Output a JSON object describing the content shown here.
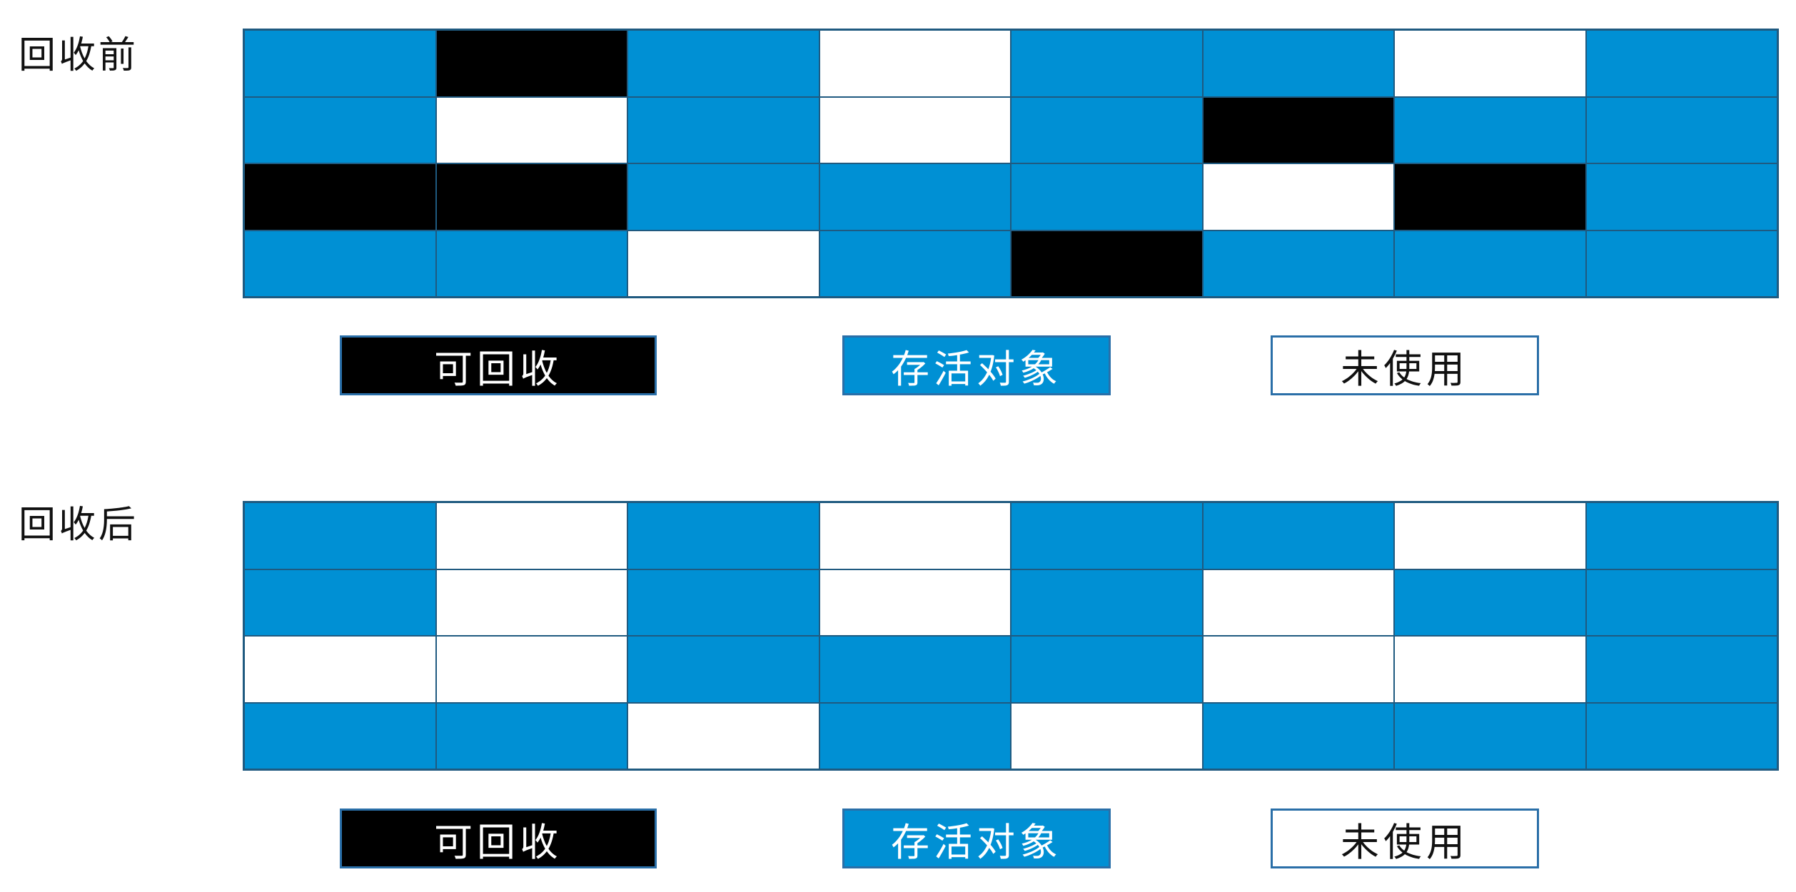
{
  "colors": {
    "recyclable": "#000000",
    "alive": "#0090d4",
    "unused": "#ffffff"
  },
  "sections": [
    {
      "label": "回收前",
      "grid": [
        [
          "alive",
          "recyclable",
          "alive",
          "unused",
          "alive",
          "alive",
          "unused",
          "alive"
        ],
        [
          "alive",
          "unused",
          "alive",
          "unused",
          "alive",
          "recyclable",
          "alive",
          "alive"
        ],
        [
          "recyclable",
          "recyclable",
          "alive",
          "alive",
          "alive",
          "unused",
          "recyclable",
          "alive"
        ],
        [
          "alive",
          "alive",
          "unused",
          "alive",
          "recyclable",
          "alive",
          "alive",
          "alive"
        ]
      ],
      "legend": [
        {
          "key": "recyclable",
          "label": "可回收"
        },
        {
          "key": "alive",
          "label": "存活对象"
        },
        {
          "key": "unused",
          "label": "未使用"
        }
      ]
    },
    {
      "label": "回收后",
      "grid": [
        [
          "alive",
          "unused",
          "alive",
          "unused",
          "alive",
          "alive",
          "unused",
          "alive"
        ],
        [
          "alive",
          "unused",
          "alive",
          "unused",
          "alive",
          "unused",
          "alive",
          "alive"
        ],
        [
          "unused",
          "unused",
          "alive",
          "alive",
          "alive",
          "unused",
          "unused",
          "alive"
        ],
        [
          "alive",
          "alive",
          "unused",
          "alive",
          "unused",
          "alive",
          "alive",
          "alive"
        ]
      ],
      "legend": [
        {
          "key": "recyclable",
          "label": "可回收"
        },
        {
          "key": "alive",
          "label": "存活对象"
        },
        {
          "key": "unused",
          "label": "未使用"
        }
      ]
    }
  ]
}
